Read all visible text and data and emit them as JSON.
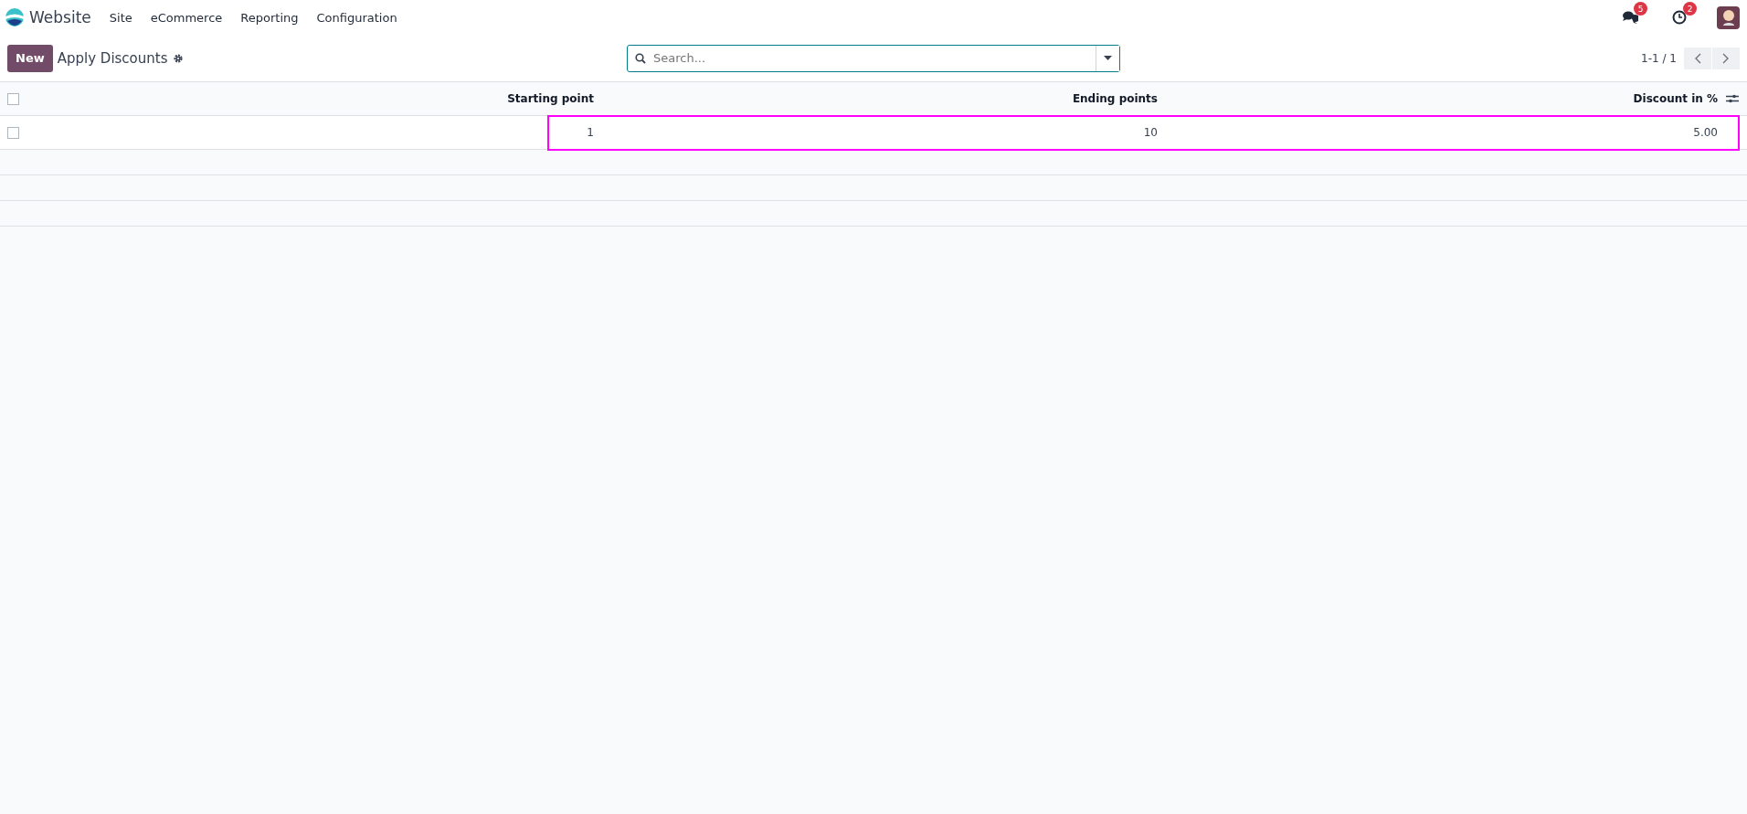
{
  "navbar": {
    "app_name": "Website",
    "menu": [
      "Site",
      "eCommerce",
      "Reporting",
      "Configuration"
    ],
    "messages_count": "5",
    "activities_count": "2"
  },
  "control_panel": {
    "new_button": "New",
    "title": "Apply Discounts",
    "search": {
      "placeholder": "Search..."
    },
    "pager": "1-1 / 1"
  },
  "table": {
    "select_all_checked": false,
    "columns": [
      "Starting point",
      "Ending points",
      "Discount in %"
    ],
    "rows": [
      {
        "checked": false,
        "highlighted": true,
        "cells": [
          "1",
          "10",
          "5.00"
        ]
      }
    ]
  }
}
